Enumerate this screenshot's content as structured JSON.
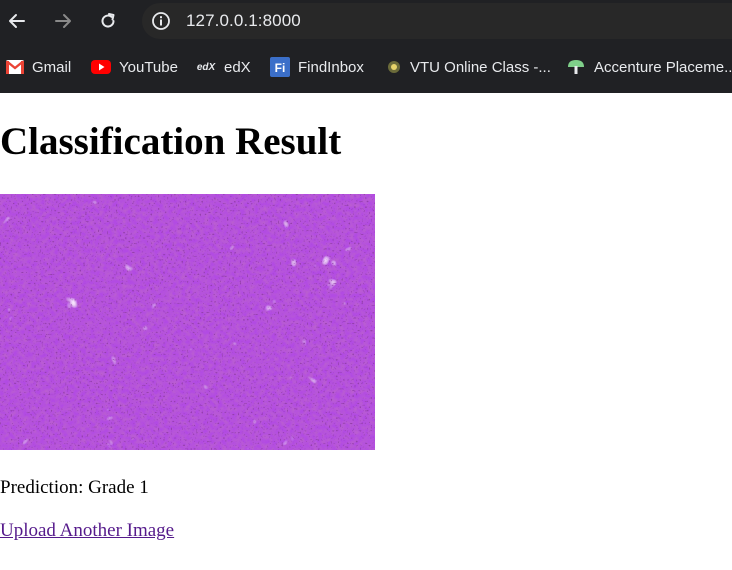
{
  "browser": {
    "url": "127.0.0.1:8000",
    "bookmarks": [
      {
        "label": "Gmail",
        "icon": "gmail-icon"
      },
      {
        "label": "YouTube",
        "icon": "youtube-icon"
      },
      {
        "label": "edX",
        "icon": "edx-icon"
      },
      {
        "label": "FindInbox",
        "icon": "findinbox-icon"
      },
      {
        "label": "VTU Online Class -...",
        "icon": "vtu-icon"
      },
      {
        "label": "Accenture Placeme...",
        "icon": "accenture-icon"
      }
    ]
  },
  "page": {
    "title": "Classification Result",
    "image_alt": "histopathology tissue image",
    "prediction": "Prediction: Grade 1",
    "link_label": "Upload Another Image"
  },
  "colors": {
    "link": "#551a8b",
    "toolbar": "#202124",
    "tissue": "#b04ae0"
  }
}
